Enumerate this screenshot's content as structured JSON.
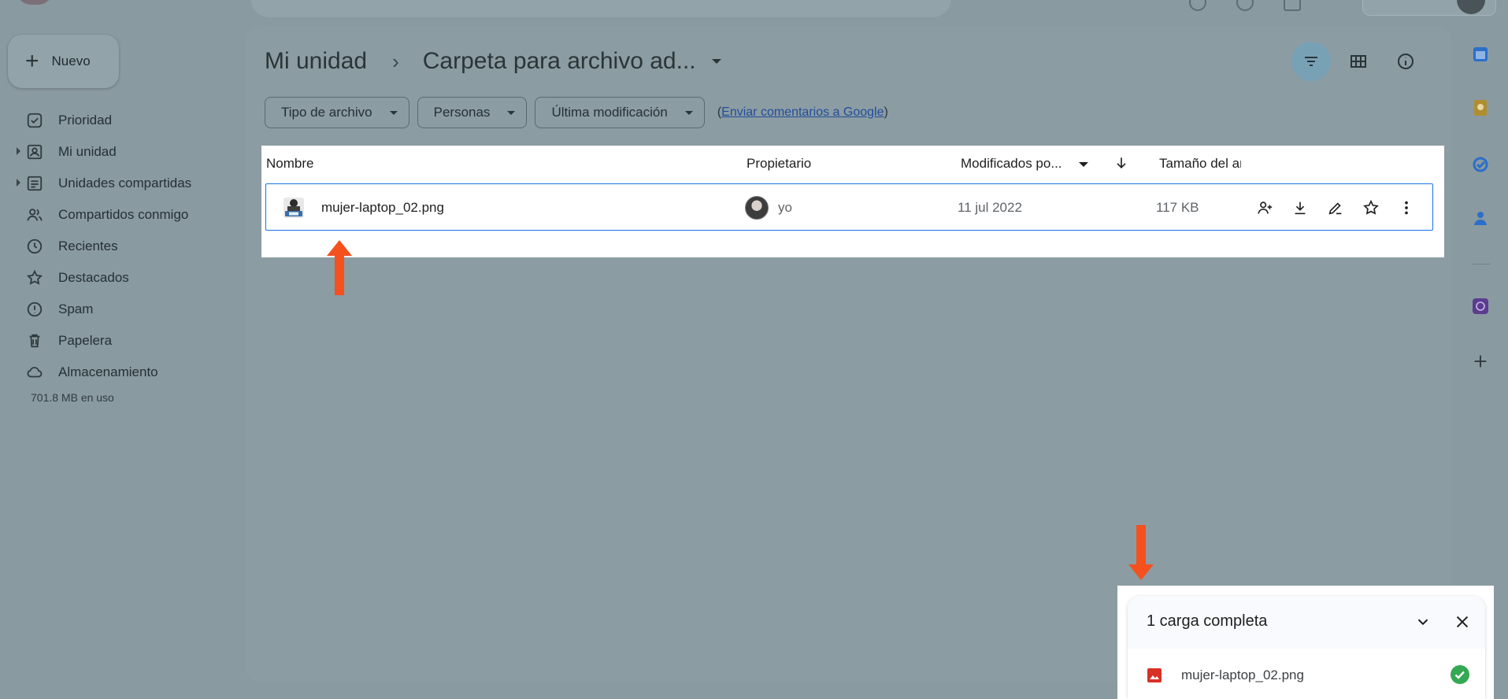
{
  "app": {
    "new_button_label": "Nuevo"
  },
  "sidebar": {
    "items": [
      {
        "label": "Prioridad",
        "icon": "priority-icon",
        "expandable": false
      },
      {
        "label": "Mi unidad",
        "icon": "my-drive-icon",
        "expandable": true
      },
      {
        "label": "Unidades compartidas",
        "icon": "shared-drives-icon",
        "expandable": true
      },
      {
        "label": "Compartidos conmigo",
        "icon": "shared-with-me-icon",
        "expandable": false
      },
      {
        "label": "Recientes",
        "icon": "clock-icon",
        "expandable": false
      },
      {
        "label": "Destacados",
        "icon": "star-icon",
        "expandable": false
      },
      {
        "label": "Spam",
        "icon": "spam-icon",
        "expandable": false
      },
      {
        "label": "Papelera",
        "icon": "trash-icon",
        "expandable": false
      },
      {
        "label": "Almacenamiento",
        "icon": "cloud-icon",
        "expandable": false
      }
    ],
    "storage_usage": "701.8 MB en uso"
  },
  "breadcrumb": {
    "root": "Mi unidad",
    "separator": "›",
    "current": "Carpeta para archivo ad..."
  },
  "filters": {
    "chips": [
      "Tipo de archivo",
      "Personas",
      "Última modificación"
    ],
    "feedback_prefix": "(",
    "feedback_link": "Enviar comentarios a Google",
    "feedback_suffix": ")"
  },
  "table": {
    "columns": {
      "name": "Nombre",
      "owner": "Propietario",
      "modified": "Modificados po...",
      "size": "Tamaño del archivo"
    },
    "rows": [
      {
        "name": "mujer-laptop_02.png",
        "owner": "yo",
        "modified": "11 jul 2022",
        "size": "117 KB"
      }
    ]
  },
  "upload": {
    "title": "1 carga completa",
    "items": [
      {
        "name": "mujer-laptop_02.png",
        "status": "complete"
      }
    ]
  },
  "colors": {
    "overlay": "#8a9aa1",
    "highlight": "#ffffff",
    "selection_border": "#1a73e8",
    "annotation_arrow": "#f4511e",
    "success": "#34a853"
  }
}
